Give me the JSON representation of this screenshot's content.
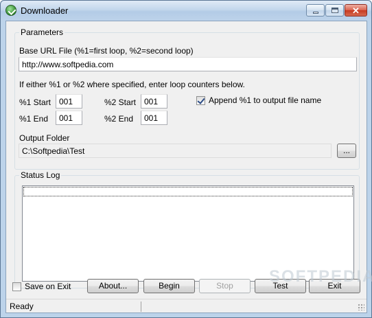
{
  "window": {
    "title": "Downloader"
  },
  "parameters": {
    "group_title": "Parameters",
    "base_url_label": "Base URL File (%1=first loop, %2=second loop)",
    "base_url_value": "http://www.softpedia.com",
    "loop_hint": "If either %1 or %2 where specified, enter loop counters below.",
    "start1_label": "%1 Start",
    "start1_value": "001",
    "end1_label": "%1 End",
    "end1_value": "001",
    "start2_label": "%2 Start",
    "start2_value": "001",
    "end2_label": "%2 End",
    "end2_value": "001",
    "append_label": "Append %1 to output file name",
    "append_checked": true,
    "output_folder_label": "Output Folder",
    "output_folder_value": "C:\\Softpedia\\Test",
    "browse_label": "..."
  },
  "status_log": {
    "group_title": "Status Log"
  },
  "bottom": {
    "save_on_exit_label": "Save on Exit",
    "save_on_exit_checked": false,
    "about_label": "About...",
    "begin_label": "Begin",
    "stop_label": "Stop",
    "test_label": "Test",
    "exit_label": "Exit"
  },
  "statusbar": {
    "text": "Ready"
  },
  "watermark": "SOFTPEDIA",
  "colors": {
    "title_gradient_top": "#dfeaf6",
    "client_bg": "#f0f0f0",
    "close_button": "#c6391f"
  }
}
